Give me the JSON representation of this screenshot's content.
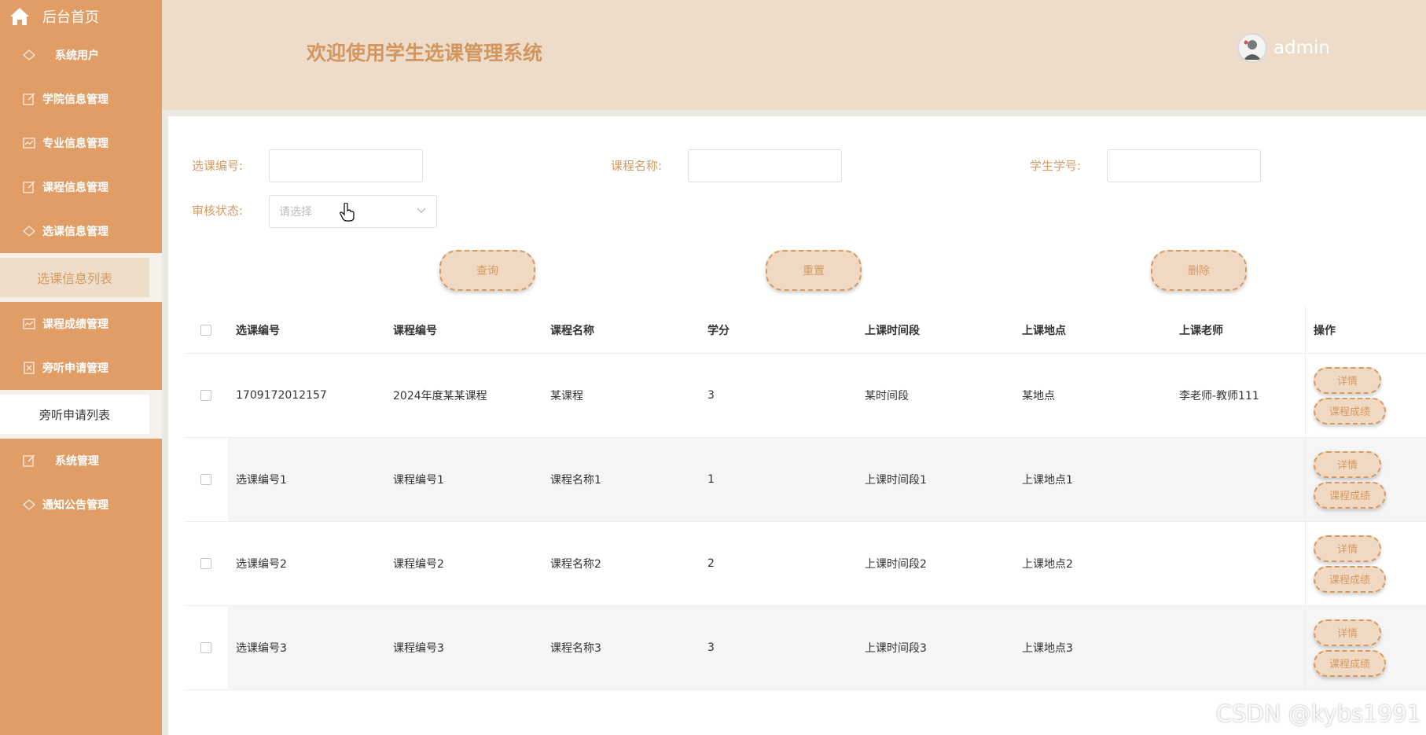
{
  "sidebar": {
    "home_label": "后台首页",
    "items": [
      {
        "label": "系统用户",
        "icon": "diamond-icon"
      },
      {
        "label": "学院信息管理",
        "icon": "edit-icon"
      },
      {
        "label": "专业信息管理",
        "icon": "chart-icon"
      },
      {
        "label": "课程信息管理",
        "icon": "edit-icon"
      },
      {
        "label": "选课信息管理",
        "icon": "diamond-icon"
      }
    ],
    "active_sub": "选课信息列表",
    "items2": [
      {
        "label": "课程成绩管理",
        "icon": "chart-icon"
      },
      {
        "label": "旁听申请管理",
        "icon": "close-box-icon"
      }
    ],
    "sub2": "旁听申请列表",
    "items3": [
      {
        "label": "系统管理",
        "icon": "edit-icon"
      },
      {
        "label": "通知公告管理",
        "icon": "diamond-icon"
      }
    ]
  },
  "header": {
    "title": "欢迎使用学生选课管理系统",
    "username": "admin"
  },
  "search": {
    "selection_id_label": "选课编号:",
    "course_name_label": "课程名称:",
    "student_no_label": "学生学号:",
    "status_label": "审核状态:",
    "status_placeholder": "请选择",
    "query_btn": "查询",
    "reset_btn": "重置",
    "delete_btn": "删除"
  },
  "table": {
    "columns": [
      "选课编号",
      "课程编号",
      "课程名称",
      "学分",
      "上课时间段",
      "上课地点",
      "上课老师",
      "操作"
    ],
    "rows": [
      [
        "1709172012157",
        "2024年度某某课程",
        "某课程",
        "3",
        "某时间段",
        "某地点",
        "李老师-教师111"
      ],
      [
        "选课编号1",
        "课程编号1",
        "课程名称1",
        "1",
        "上课时间段1",
        "上课地点1",
        ""
      ],
      [
        "选课编号2",
        "课程编号2",
        "课程名称2",
        "2",
        "上课时间段2",
        "上课地点2",
        ""
      ],
      [
        "选课编号3",
        "课程编号3",
        "课程名称3",
        "3",
        "上课时间段3",
        "上课地点3",
        ""
      ]
    ],
    "detail_btn": "详情",
    "grade_btn": "课程成绩"
  },
  "watermark": "CSDN @kybs1991",
  "colors": {
    "sidebar": "#e09e66",
    "header": "#eddcca",
    "accent": "#d59a62"
  }
}
